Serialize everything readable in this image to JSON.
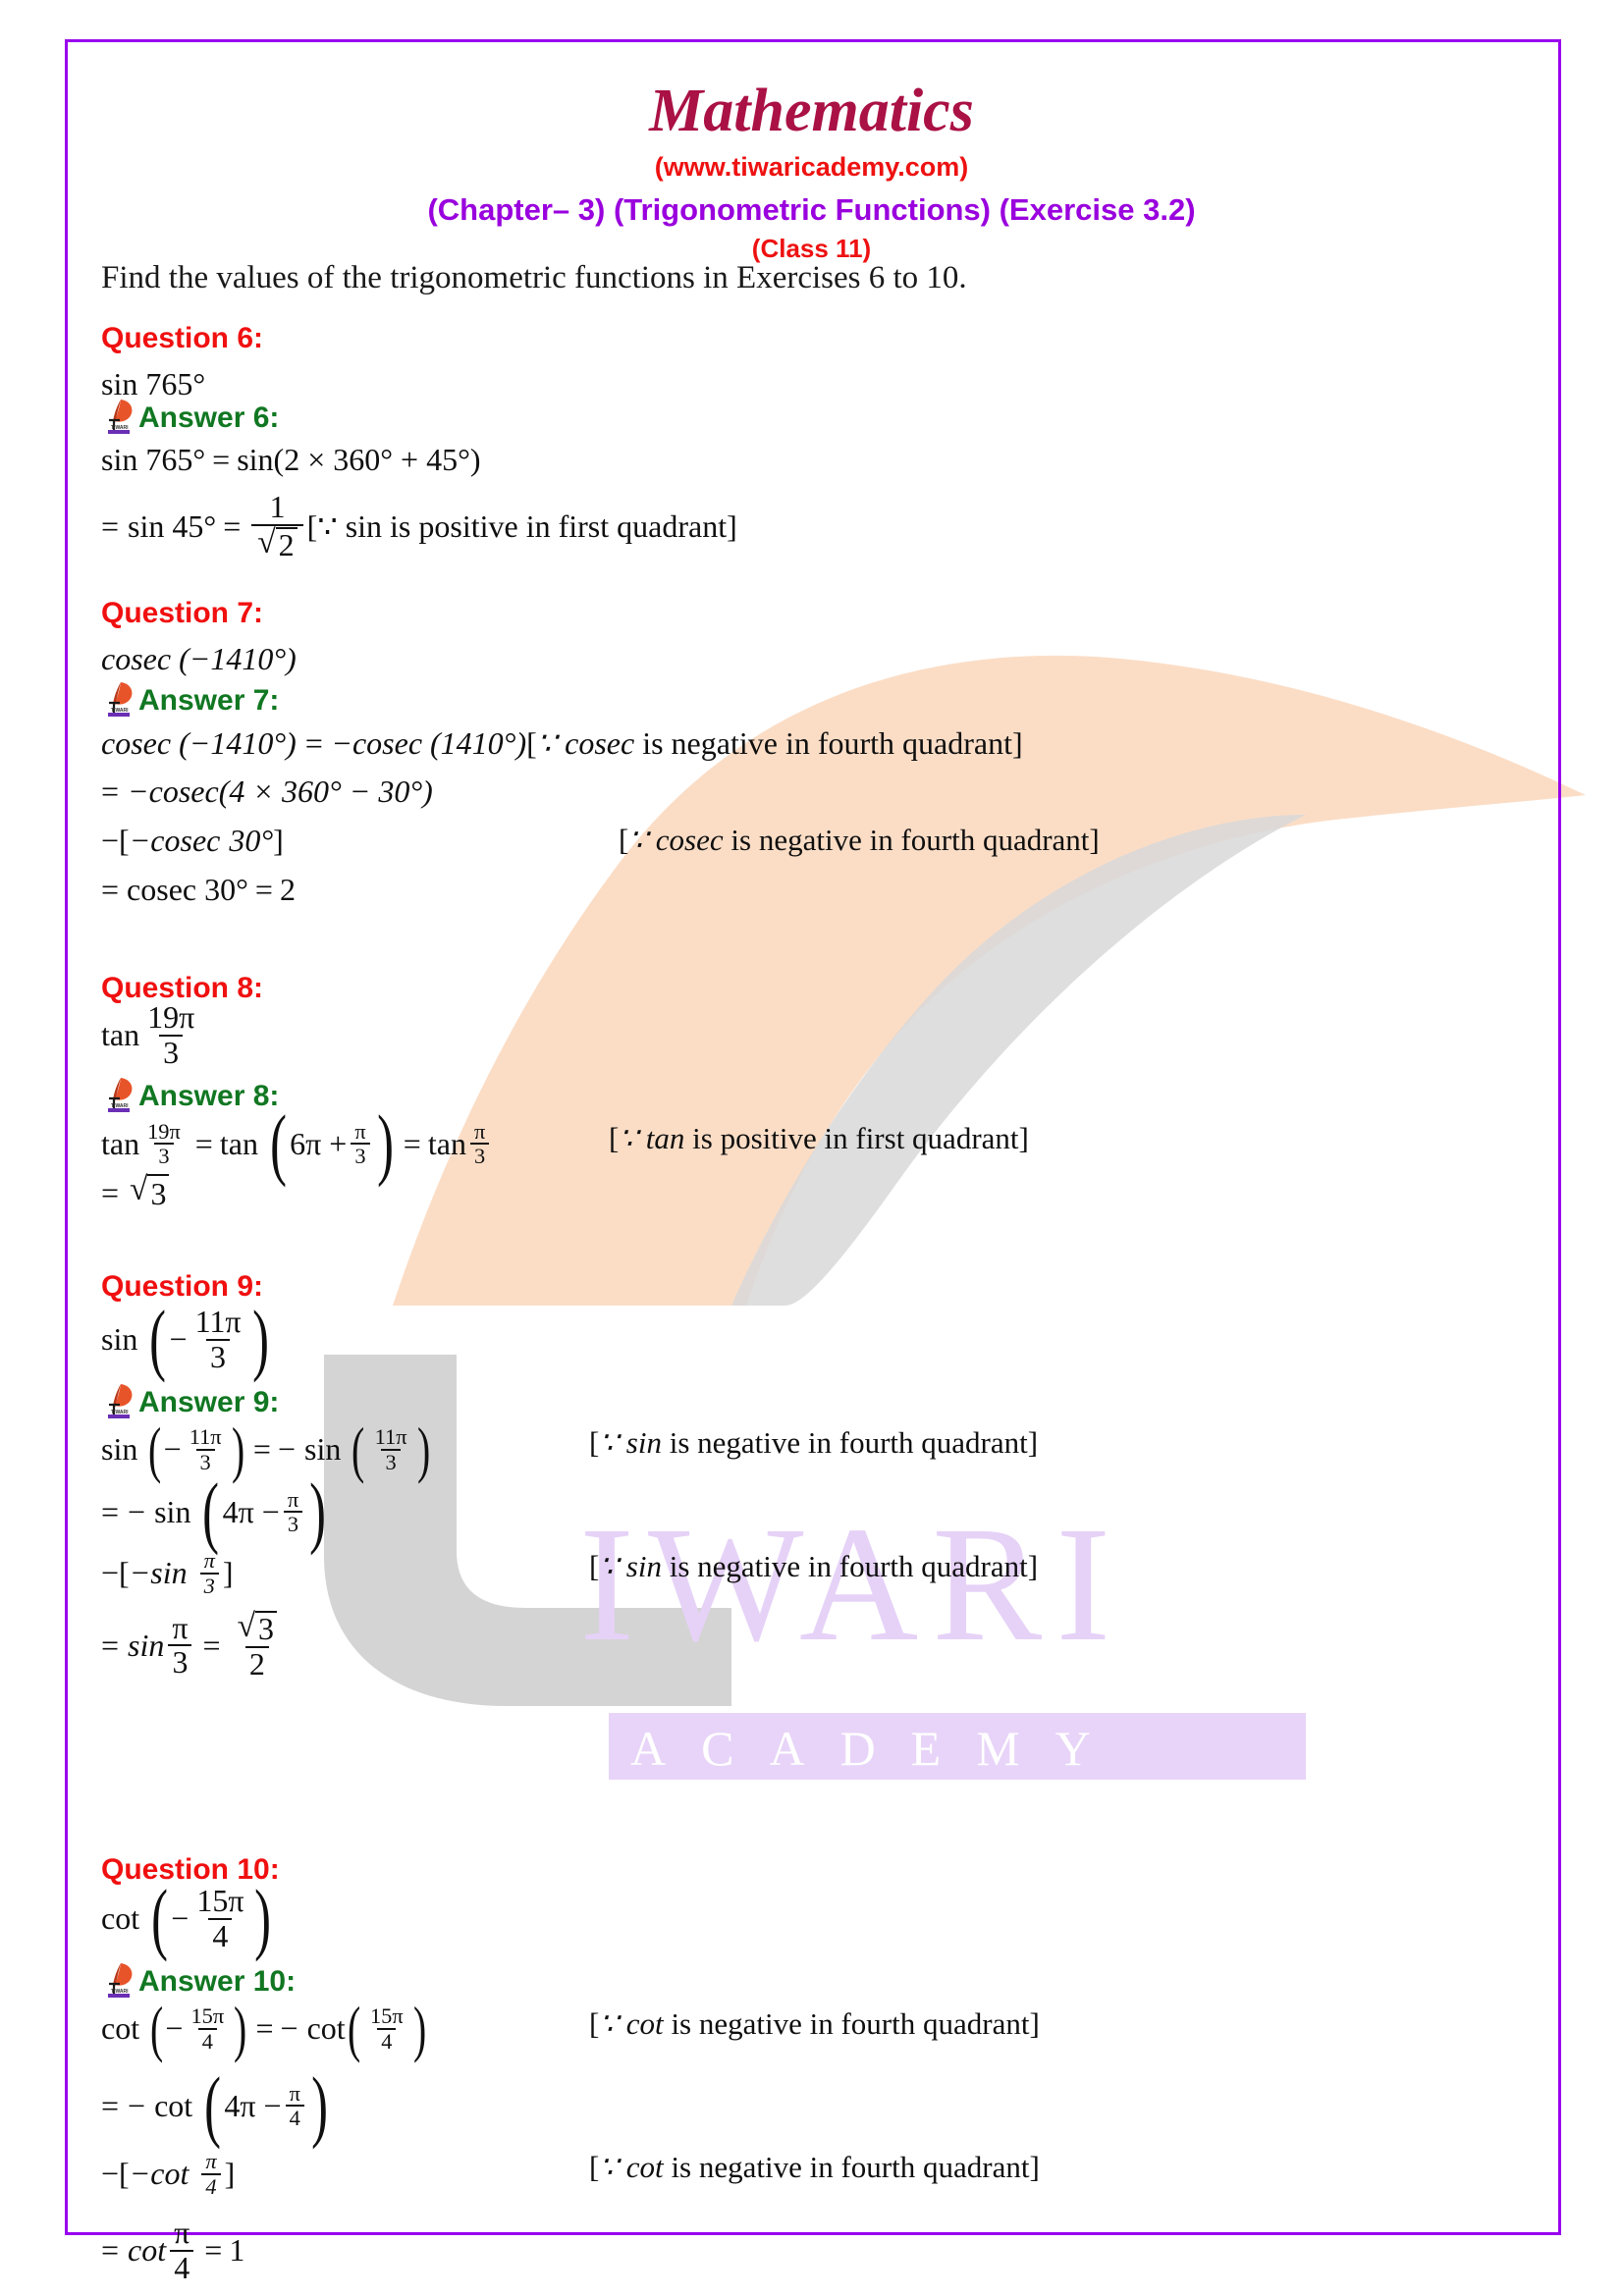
{
  "document": {
    "title": "Mathematics",
    "website": "(www.tiwaricademy.com)",
    "chapter_line": "(Chapter– 3) (Trigonometric Functions) (Exercise 3.2)",
    "class_line": "(Class 11)",
    "intro": "Find the values of the trigonometric functions in Exercises 6 to 10."
  },
  "colors": {
    "border": "#9900ee",
    "title": "#aa1144",
    "website": "#ee1111",
    "chapter": "#9900dd",
    "question": "#f01010",
    "answer": "#117722",
    "watermark_leaf": "#fbddc6",
    "watermark_stem": "#d4d4d4",
    "watermark_text": "#e6d2f7",
    "watermark_bar": "#e8d4f8"
  },
  "watermark": {
    "letter_t": "t",
    "word": "IWARI",
    "academy": "ACADEMY"
  },
  "icons": {
    "answer_logo": "tiwari-quill-logo-icon",
    "logo_caption": "TIWARI"
  },
  "questions": [
    {
      "id": "q6",
      "question_label": "Question 6:",
      "question_expr": "sin 765°",
      "answer_label": "Answer 6:",
      "lines": [
        {
          "expr": "sin 765° = sin(2 × 360° + 45°)",
          "note": ""
        },
        {
          "expr": "= sin 45° = 1/√2",
          "note": "[∵ sin is positive in first quadrant]"
        }
      ]
    },
    {
      "id": "q7",
      "question_label": "Question 7:",
      "question_expr": "cosec (−1410°)",
      "answer_label": "Answer 7:",
      "lines": [
        {
          "expr": "cosec (−1410°) = −cosec (1410°)",
          "note": "[∵ cosec is negative in fourth quadrant]"
        },
        {
          "expr": "= −cosec(4 × 360° − 30°)",
          "note": ""
        },
        {
          "expr": "−[−cosec 30°]",
          "note": "[∵ cosec is negative in fourth quadrant]"
        },
        {
          "expr": "= cosec 30° = 2",
          "note": ""
        }
      ]
    },
    {
      "id": "q8",
      "question_label": "Question 8:",
      "question_expr": "tan 19π/3",
      "answer_label": "Answer 8:",
      "lines": [
        {
          "expr": "tan 19π/3 = tan (6π + π/3) = tan π/3",
          "note": "[∵ tan is positive in first quadrant]"
        },
        {
          "expr": "= √3",
          "note": ""
        }
      ]
    },
    {
      "id": "q9",
      "question_label": "Question 9:",
      "question_expr": "sin (− 11π/3)",
      "answer_label": "Answer 9:",
      "lines": [
        {
          "expr": "sin (− 11π/3) = − sin (11π/3)",
          "note": "[∵ sin is negative in fourth quadrant]"
        },
        {
          "expr": "= − sin (4π − π/3)",
          "note": ""
        },
        {
          "expr": "−[−sin π/3]",
          "note": "[∵ sin is negative in fourth quadrant]"
        },
        {
          "expr": "= sin π/3 = √3/2",
          "note": ""
        }
      ]
    },
    {
      "id": "q10",
      "question_label": "Question 10:",
      "question_expr": "cot (− 15π/4)",
      "answer_label": "Answer 10:",
      "lines": [
        {
          "expr": "cot (− 15π/4) = − cot (15π/4)",
          "note": "[∵ cot is negative in fourth quadrant]"
        },
        {
          "expr": "= − cot (4π − π/4)",
          "note": ""
        },
        {
          "expr": "−[−cot π/4]",
          "note": "[∵ cot is negative in fourth quadrant]"
        },
        {
          "expr": "= cot π/4 = 1",
          "note": ""
        }
      ]
    }
  ],
  "math_tokens": {
    "sin": "sin",
    "cos": "cos",
    "tan": "tan",
    "cot": "cot",
    "cosec": "cosec",
    "pi": "π",
    "deg": "°",
    "minus": "−",
    "times": "×",
    "eq": "=",
    "because": "∵",
    "radical": "√",
    "n765": "765",
    "n2": "2",
    "n360": "360",
    "n45": "45",
    "n1": "1",
    "n1410": "1410",
    "n4": "4",
    "n30": "30",
    "n19": "19",
    "n3": "3",
    "n6": "6",
    "n11": "11",
    "n15": "15"
  }
}
